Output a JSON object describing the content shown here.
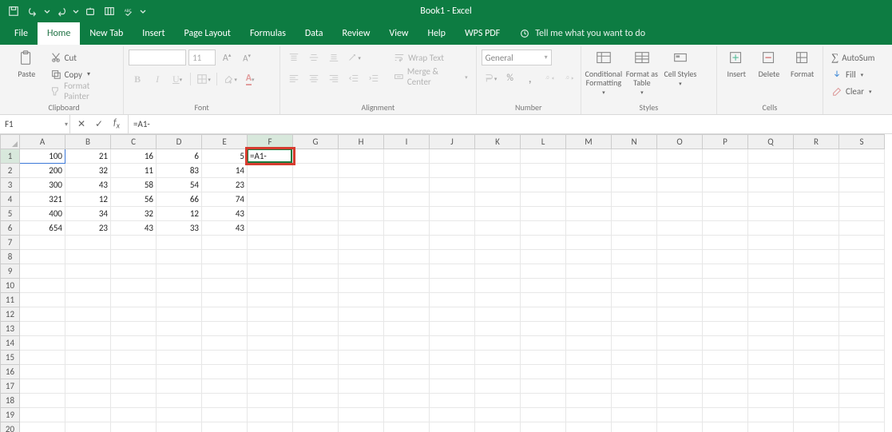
{
  "title": "Book1  -  Excel",
  "qat": [
    "save",
    "undo",
    "redo",
    "touchmode",
    "cols",
    "spellcheck"
  ],
  "tabs": [
    {
      "label": "File",
      "id": "file"
    },
    {
      "label": "Home",
      "id": "home",
      "active": true
    },
    {
      "label": "New Tab",
      "id": "newtab"
    },
    {
      "label": "Insert",
      "id": "insert"
    },
    {
      "label": "Page Layout",
      "id": "pagelayout"
    },
    {
      "label": "Formulas",
      "id": "formulas"
    },
    {
      "label": "Data",
      "id": "data"
    },
    {
      "label": "Review",
      "id": "review"
    },
    {
      "label": "View",
      "id": "view"
    },
    {
      "label": "Help",
      "id": "help"
    },
    {
      "label": "WPS PDF",
      "id": "wpspdf"
    }
  ],
  "tellme": "Tell me what you want to do",
  "ribbon": {
    "clipboard": {
      "paste": "Paste",
      "cut": "Cut",
      "copy": "Copy",
      "formatpainter": "Format Painter",
      "label": "Clipboard"
    },
    "font": {
      "name": "",
      "size": "11",
      "label": "Font",
      "biu": {
        "b": "B",
        "i": "I",
        "u": "U"
      },
      "a_up": "A",
      "a_dn": "A"
    },
    "alignment": {
      "wrap": "Wrap Text",
      "merge": "Merge & Center",
      "label": "Alignment"
    },
    "number": {
      "format": "General",
      "label": "Number"
    },
    "styles": {
      "cond": "Conditional Formatting",
      "tbl": "Format as Table",
      "cell": "Cell Styles",
      "label": "Styles"
    },
    "cells": {
      "insert": "Insert",
      "delete": "Delete",
      "format": "Format",
      "label": "Cells"
    },
    "editing": {
      "autosum": "AutoSum",
      "fill": "Fill",
      "clear": "Clear"
    }
  },
  "namebox": "F1",
  "formula": "=A1-",
  "cols": [
    "A",
    "B",
    "C",
    "D",
    "E",
    "F",
    "G",
    "H",
    "I",
    "J",
    "K",
    "L",
    "M",
    "N",
    "O",
    "P",
    "Q",
    "R",
    "S"
  ],
  "rows": 20,
  "active_cell_display": "=A1-",
  "cells": {
    "A1": "100",
    "B1": "21",
    "C1": "16",
    "D1": "6",
    "E1": "5",
    "A2": "200",
    "B2": "32",
    "C2": "11",
    "D2": "83",
    "E2": "14",
    "A3": "300",
    "B3": "43",
    "C3": "58",
    "D3": "54",
    "E3": "23",
    "A4": "321",
    "B4": "12",
    "C4": "56",
    "D4": "66",
    "E4": "74",
    "A5": "400",
    "B5": "34",
    "C5": "32",
    "D5": "12",
    "E5": "43",
    "A6": "654",
    "B6": "23",
    "C6": "43",
    "D6": "33",
    "E6": "43"
  }
}
